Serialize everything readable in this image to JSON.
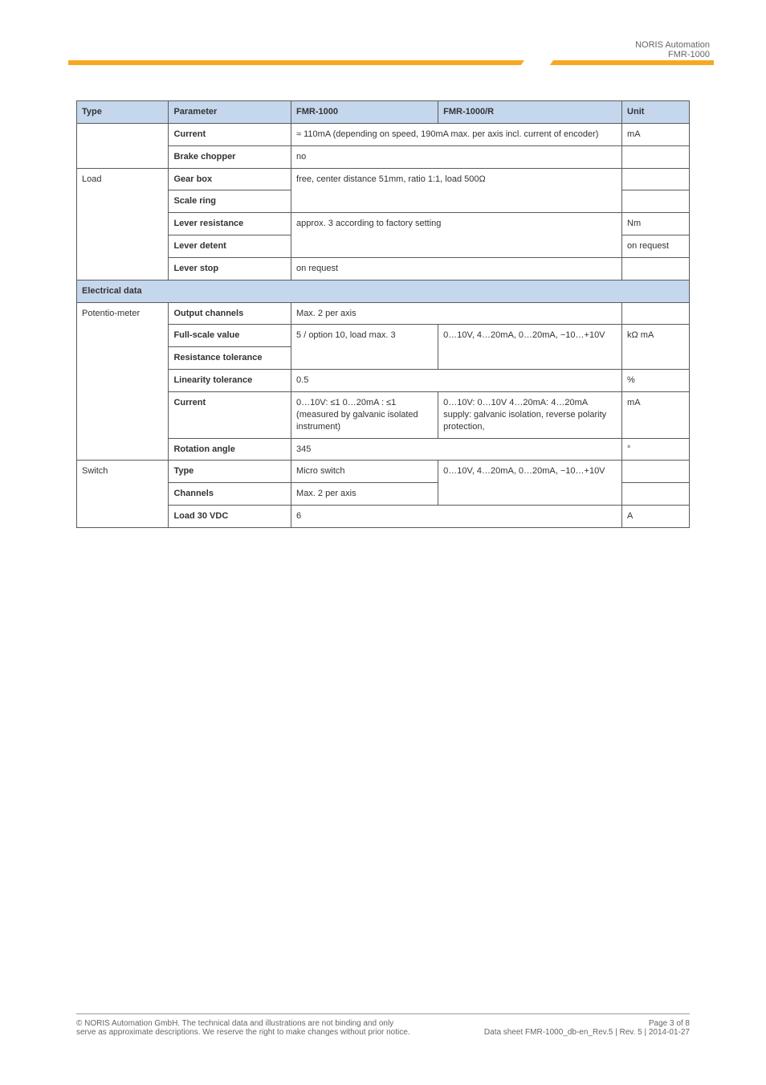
{
  "header": {
    "brand": "NORIS Automation",
    "model": "FMR-1000"
  },
  "table": {
    "headers": [
      "Type",
      "Parameter",
      "FMR-1000",
      "FMR-1000/R",
      "Unit"
    ],
    "rows": [
      {
        "type": "",
        "param": "Current",
        "c3": "≈ 110mA (depending on speed, 190mA max. per axis incl. current of encoder)",
        "c4": "",
        "unit": "mA"
      },
      {
        "type": "",
        "param": "Brake chopper",
        "c3": "no",
        "c4": "",
        "unit": ""
      },
      {
        "type": "Load",
        "param": "Gear box",
        "c3": "free, center distance 51mm, ratio 1:1, load 500Ω",
        "c4": "",
        "unit": ""
      },
      {
        "type": "",
        "param": "Scale ring",
        "c3": "",
        "c4": "",
        "unit": ""
      },
      {
        "type": "",
        "param": "Lever resistance",
        "c3": "approx. 3 according to factory setting",
        "c4": "",
        "unit": "Nm"
      },
      {
        "type": "",
        "param": "Lever detent",
        "c3": "",
        "c4": "on request",
        "unit": ""
      },
      {
        "type": "",
        "param": "Lever stop",
        "c3": "on request",
        "c4": "",
        "unit": ""
      },
      {
        "section": "Electrical data"
      },
      {
        "type": "Potentio-meter",
        "param": "Output channels",
        "c3": "Max. 2 per axis",
        "c4": "",
        "unit": ""
      },
      {
        "type": "",
        "param": "Full-scale value",
        "c3": "5 / option 10,\nload max. 3",
        "c4": "0…10V, 4…20mA,\n0…20mA, −10…+10V",
        "unit": "kΩ\nmA",
        "rowspan_c3": 2,
        "rowspan_c4": 2,
        "rowspan_u": 2
      },
      {
        "type": "",
        "param": "Resistance tolerance",
        "c3": "",
        "c4": "",
        "unit": ""
      },
      {
        "type": "",
        "param": "Linearity tolerance",
        "c3": "0.5",
        "c4": "",
        "unit": "%"
      },
      {
        "type": "Potentio-meter2",
        "param": "Current",
        "c3": "0…10V: ≤1\n0…20mA : ≤1 (measured by galvanic isolated instrument)",
        "c4": "0…10V: 0…10V\n4…20mA: 4…20mA\nsupply: galvanic isolation, reverse polarity protection,",
        "unit": "mA"
      },
      {
        "type": "",
        "param": "Rotation angle",
        "c3": "345",
        "c4": "",
        "unit": "°"
      },
      {
        "type": "Switch",
        "param": "Type",
        "c3": "Micro switch",
        "c4": "0…10V, 4…20mA,\n0…20mA, −10…+10V",
        "unit": "",
        "rowspan_c4": 2
      },
      {
        "type": "",
        "param": "Channels",
        "c3": "Max. 2 per axis",
        "c4": "",
        "unit": ""
      },
      {
        "type": "",
        "param": "Load 30 VDC",
        "c3": "6",
        "c4": "",
        "unit": "A"
      }
    ]
  },
  "footer": {
    "left": "© NORIS Automation GmbH. The technical data and illustrations are not binding and only serve as approximate descriptions. We reserve the right to make changes without prior notice.",
    "right": "Page 3 of 8\nData sheet FMR-1000_db-en_Rev.5 | Rev. 5 | 2014-01-27"
  }
}
